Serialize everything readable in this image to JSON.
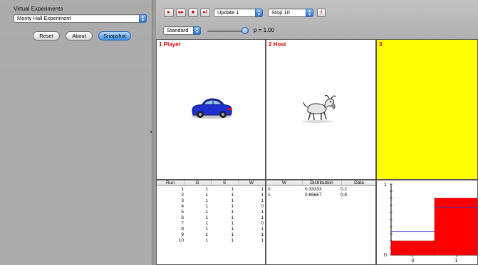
{
  "sidebar": {
    "section_label": "Virtual Experiments",
    "experiment_select": "Monty Hall Experiment",
    "buttons": {
      "reset": "Reset",
      "about": "About",
      "snapshot": "Snapshot"
    }
  },
  "toolbar": {
    "play_icon": "▸",
    "step_icon": "▸▸",
    "stop_icon": "■",
    "reset_icon": "▸I",
    "update_select": "Update 1",
    "stop_select": "Stop 10",
    "info_icon": "i",
    "strategy_select": "Standard",
    "p_label": "p = 1.00",
    "p_value": 1.0
  },
  "panels": {
    "player": {
      "title": "1 Player",
      "icon": "car-icon",
      "car_color": "#1f2fd0"
    },
    "host": {
      "title": "2 Host",
      "icon": "goat-icon"
    },
    "door3": {
      "title": "3",
      "color": "#ffff00"
    }
  },
  "run_table": {
    "headers": [
      "Run",
      "G",
      "S",
      "W"
    ],
    "rows": [
      [
        "1",
        "1",
        "1",
        "1"
      ],
      [
        "2",
        "1",
        "1",
        "1"
      ],
      [
        "3",
        "1",
        "1",
        "1"
      ],
      [
        "4",
        "1",
        "1",
        "0"
      ],
      [
        "5",
        "1",
        "1",
        "1"
      ],
      [
        "6",
        "1",
        "1",
        "1"
      ],
      [
        "7",
        "1",
        "1",
        "0"
      ],
      [
        "8",
        "1",
        "1",
        "1"
      ],
      [
        "9",
        "1",
        "1",
        "1"
      ],
      [
        "10",
        "1",
        "1",
        "1"
      ]
    ]
  },
  "dist_table": {
    "headers": [
      "W",
      "Distribution",
      "Data"
    ],
    "rows": [
      [
        "0",
        "0.33333",
        "0.2"
      ],
      [
        "1",
        "0.66667",
        "0.8"
      ]
    ]
  },
  "chart_data": {
    "type": "bar",
    "categories": [
      "0",
      "1"
    ],
    "series": [
      {
        "values": [
          0.2,
          0.8
        ],
        "color": "#ff0000"
      },
      {
        "values": [
          0.33333,
          0.66667
        ],
        "color": "#3333cc"
      }
    ],
    "x_tick_labels": [
      "0",
      "1"
    ],
    "y_tick_labels": [
      "1",
      "0"
    ],
    "ylim": [
      0,
      1
    ]
  }
}
